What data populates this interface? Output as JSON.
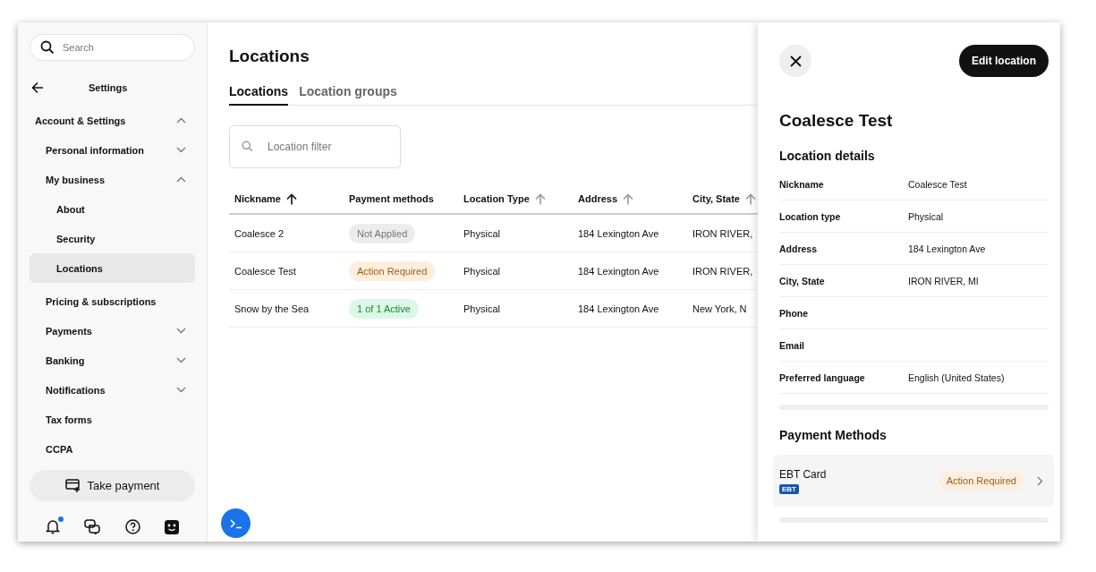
{
  "sidebar": {
    "search": {
      "placeholder": "Search"
    },
    "title": "Settings",
    "nav": [
      {
        "label": "Account & Settings",
        "expanded": true,
        "selected": false,
        "children": [
          {
            "label": "Personal information",
            "expanded": false,
            "selected": false
          },
          {
            "label": "My business",
            "expanded": true,
            "selected": false,
            "children": [
              {
                "label": "About",
                "selected": false
              },
              {
                "label": "Security",
                "selected": false
              },
              {
                "label": "Locations",
                "selected": true
              }
            ]
          },
          {
            "label": "Pricing & subscriptions",
            "selected": false
          },
          {
            "label": "Payments",
            "expanded": false,
            "selected": false
          },
          {
            "label": "Banking",
            "expanded": false,
            "selected": false
          },
          {
            "label": "Notifications",
            "expanded": false,
            "selected": false
          },
          {
            "label": "Tax forms",
            "selected": false
          },
          {
            "label": "CCPA",
            "selected": false
          }
        ]
      }
    ],
    "take_payment": "Take payment",
    "notifications_unread": true
  },
  "main": {
    "title": "Locations",
    "tabs": [
      {
        "label": "Locations",
        "selected": true
      },
      {
        "label": "Location groups",
        "selected": false
      }
    ],
    "filter": {
      "placeholder": "Location filter"
    },
    "table": {
      "columns": [
        {
          "label": "Nickname",
          "sorted": true
        },
        {
          "label": "Payment methods"
        },
        {
          "label": "Location Type",
          "sorted": false
        },
        {
          "label": "Address",
          "sorted": false
        },
        {
          "label": "City, State",
          "sorted": false
        }
      ],
      "rows": [
        {
          "nickname": "Coalesce 2",
          "payment": {
            "label": "Not Applied",
            "kind": "neutral"
          },
          "type": "Physical",
          "address": "184 Lexington Ave",
          "city": "IRON RIVER,"
        },
        {
          "nickname": "Coalesce Test",
          "payment": {
            "label": "Action Required",
            "kind": "warning"
          },
          "type": "Physical",
          "address": "184 Lexington Ave",
          "city": "IRON RIVER,"
        },
        {
          "nickname": "Snow by the Sea",
          "payment": {
            "label": "1 of 1 Active",
            "kind": "success"
          },
          "type": "Physical",
          "address": "184 Lexington Ave",
          "city": "New York, N"
        }
      ]
    }
  },
  "panel": {
    "edit_button": "Edit location",
    "title": "Coalesce Test",
    "details_heading": "Location details",
    "details": [
      {
        "label": "Nickname",
        "value": "Coalesce Test"
      },
      {
        "label": "Location type",
        "value": "Physical"
      },
      {
        "label": "Address",
        "value": "184 Lexington Ave"
      },
      {
        "label": "City, State",
        "value": "IRON RIVER, MI"
      },
      {
        "label": "Phone"
      },
      {
        "label": "Email"
      },
      {
        "label": "Preferred language",
        "value": "English (United States)"
      }
    ],
    "payment_heading": "Payment Methods",
    "payment_methods": [
      {
        "name": "EBT Card",
        "logo": "EBT",
        "status": {
          "label": "Action Required",
          "kind": "warning"
        }
      }
    ]
  }
}
